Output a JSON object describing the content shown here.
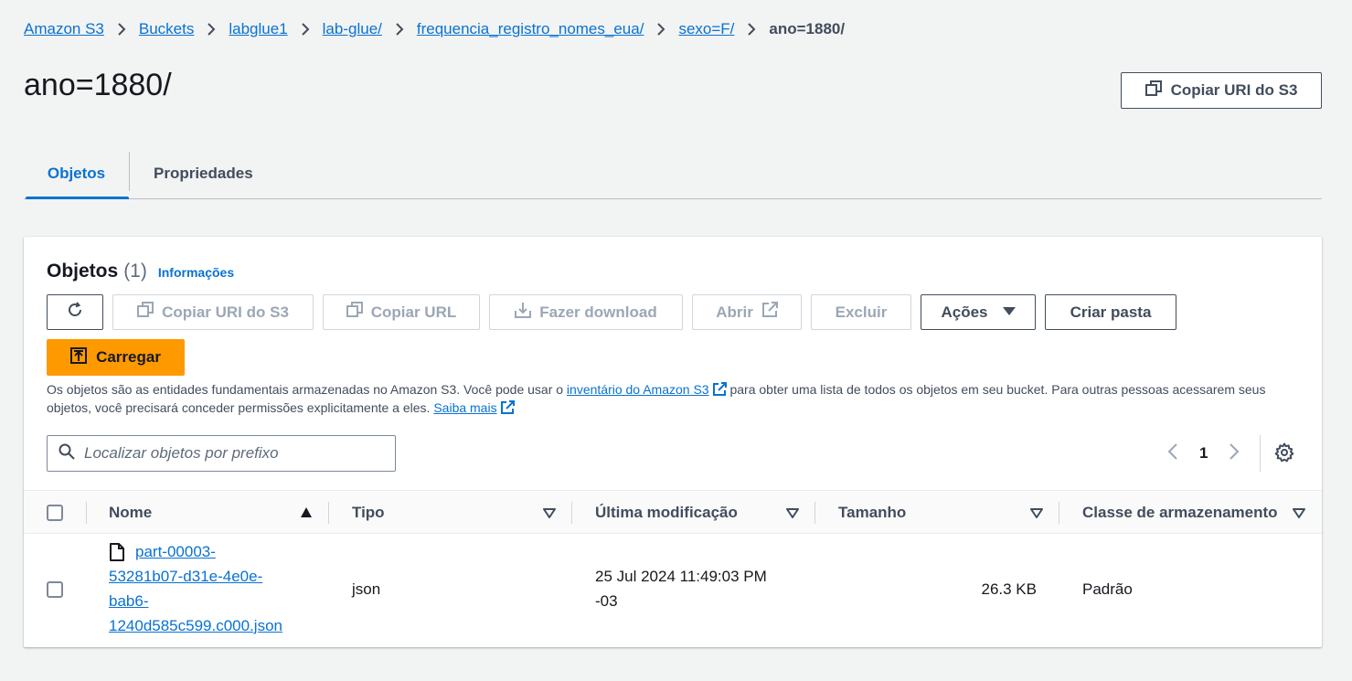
{
  "breadcrumb": {
    "items": [
      "Amazon S3",
      "Buckets",
      "labglue1",
      "lab-glue/",
      "frequencia_registro_nomes_eua/",
      "sexo=F/"
    ],
    "current": "ano=1880/"
  },
  "page": {
    "title": "ano=1880/",
    "copy_uri_label": "Copiar URI do S3"
  },
  "tabs": [
    "Objetos",
    "Propriedades"
  ],
  "objects_panel": {
    "title": "Objetos",
    "count": "(1)",
    "info_link": "Informações",
    "buttons": {
      "copy_uri": "Copiar URI do S3",
      "copy_url": "Copiar URL",
      "download": "Fazer download",
      "open": "Abrir",
      "delete": "Excluir",
      "actions": "Ações",
      "create_folder": "Criar pasta",
      "upload": "Carregar"
    },
    "description": {
      "part1": "Os objetos são as entidades fundamentais armazenadas no Amazon S3. Você pode usar o ",
      "link1": "inventário do Amazon S3",
      "part2": " para obter uma lista de todos os objetos em seu bucket. Para outras pessoas acessarem seus objetos, você precisará conceder permissões explicitamente a eles. ",
      "link2": "Saiba mais"
    },
    "search_placeholder": "Localizar objetos por prefixo",
    "page_number": "1"
  },
  "table": {
    "columns": [
      "Nome",
      "Tipo",
      "Última modificação",
      "Tamanho",
      "Classe de armazenamento"
    ],
    "rows": [
      {
        "name_lines": [
          "part-00003-",
          "53281b07-d31e-4e0e-",
          "bab6-",
          "1240d585c599.c000.json"
        ],
        "type": "json",
        "modified_lines": [
          "25 Jul 2024 11:49:03 PM",
          "-03"
        ],
        "size": "26.3 KB",
        "storage_class": "Padrão"
      }
    ]
  },
  "colors": {
    "link": "#0972d3",
    "primary_button": "#ff9900",
    "background": "#f2f3f3"
  }
}
